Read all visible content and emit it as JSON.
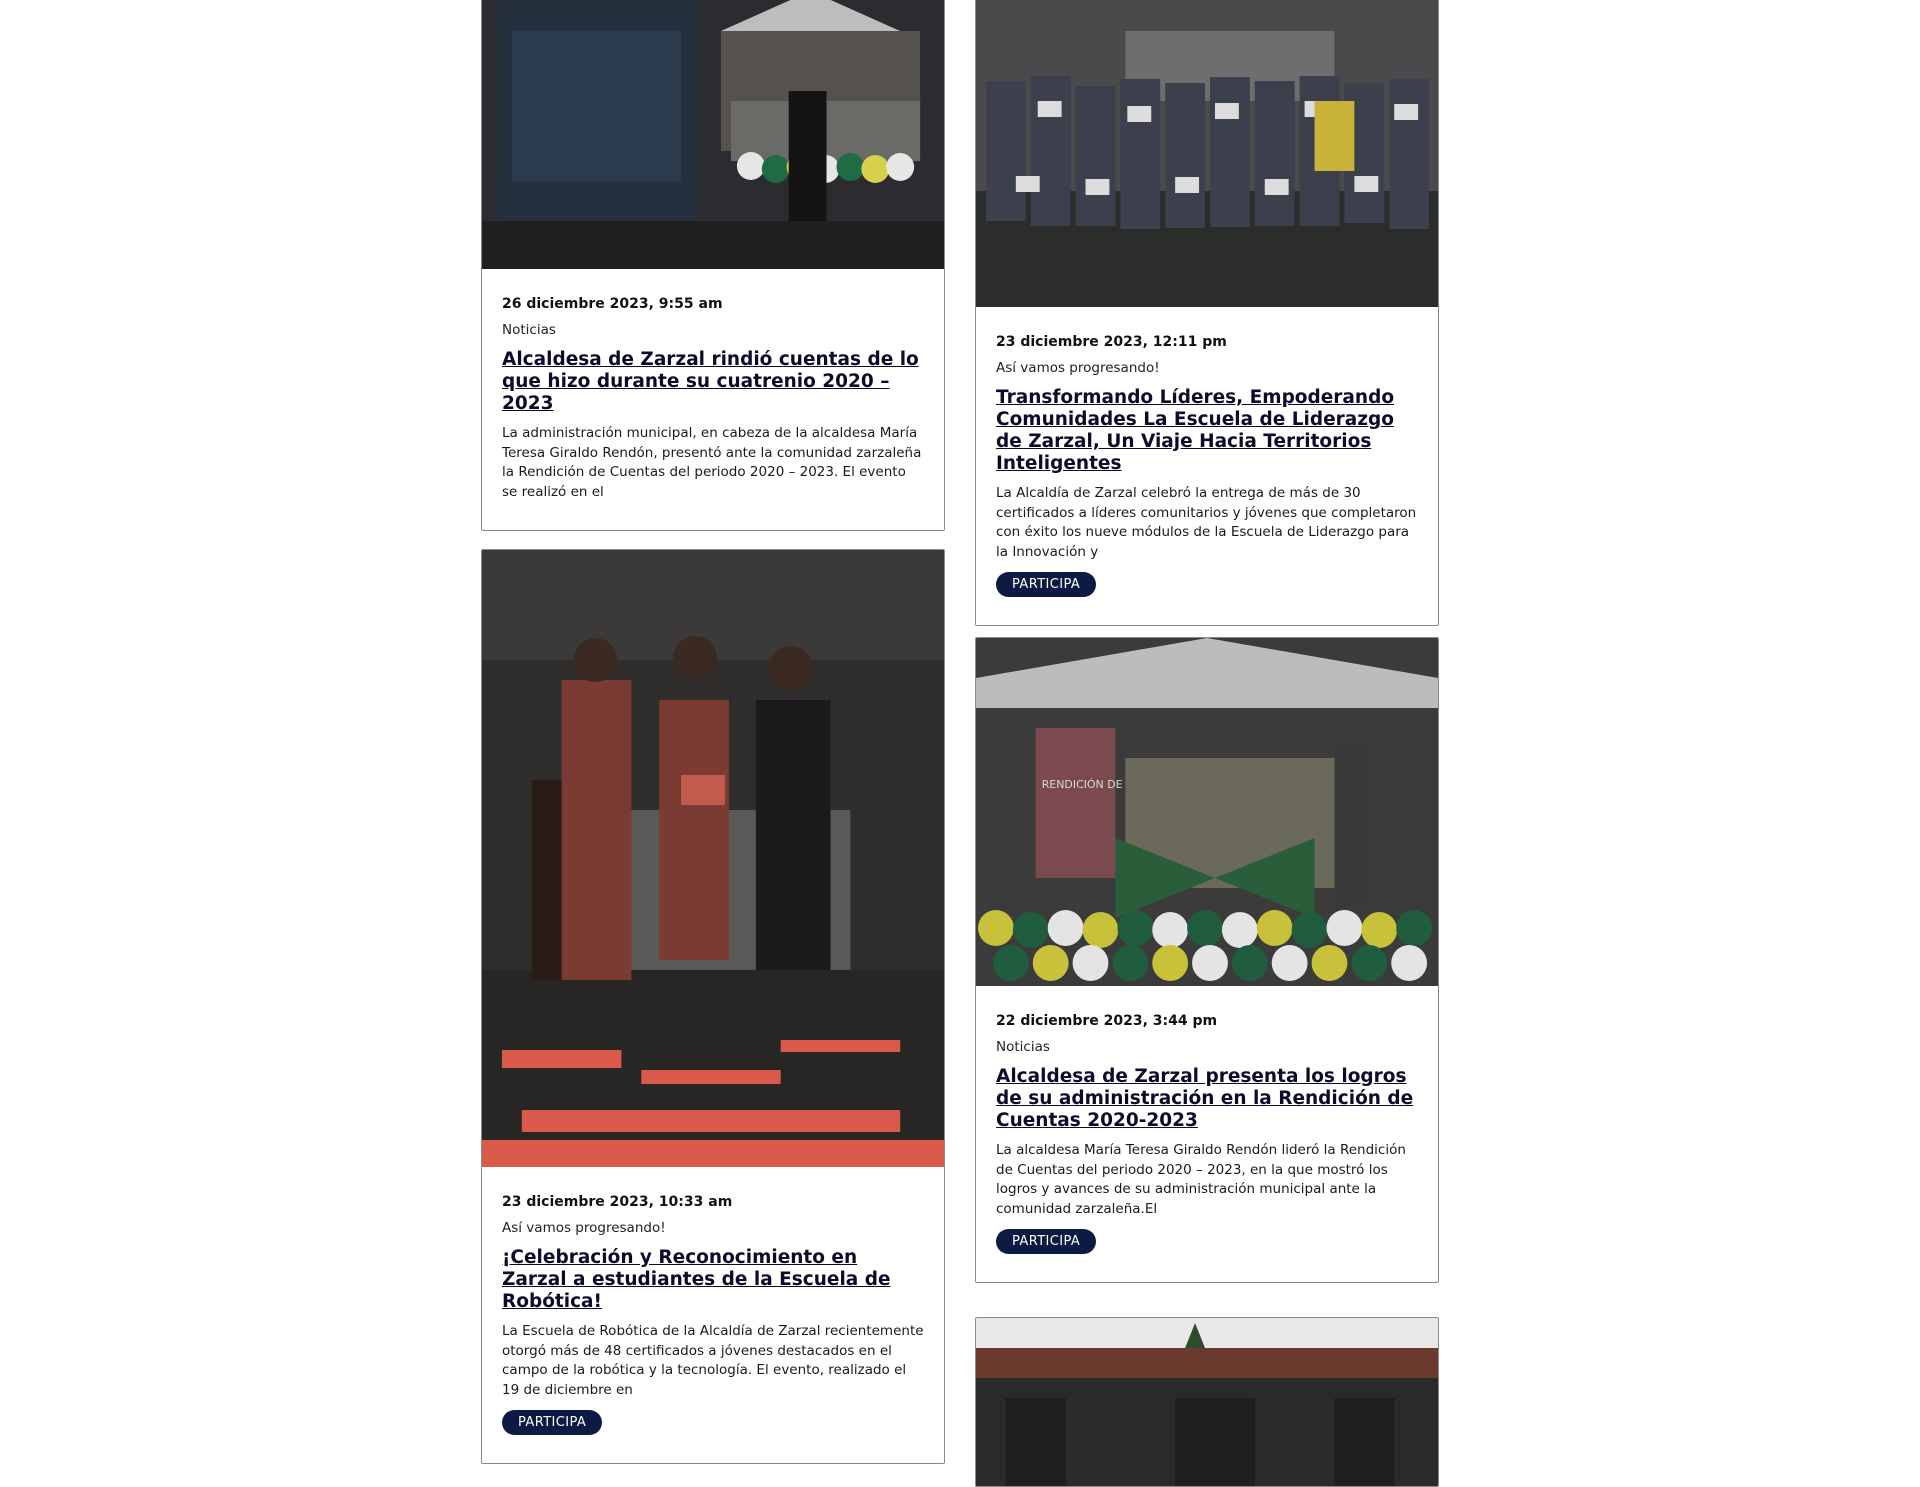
{
  "cards": [
    {
      "date": "26 diciembre 2023, 9:55 am",
      "category": "Noticias",
      "title": "Alcaldesa de Zarzal rindió cuentas de lo que hizo durante su cuatrenio 2020 – 2023",
      "excerpt": " La administración municipal, en cabeza de la alcaldesa María Teresa Giraldo Rendón, presentó ante la comunidad zarzaleña la Rendición de Cuentas del periodo 2020 – 2023. El evento se realizó en el"
    },
    {
      "date": "23 diciembre 2023, 12:11 pm",
      "category": "Así vamos progresando!",
      "title": "Transformando Líderes, Empoderando Comunidades La Escuela de Liderazgo de Zarzal, Un Viaje Hacia Territorios Inteligentes",
      "excerpt": "La Alcaldía de Zarzal celebró la entrega de más de 30 certificados a líderes comunitarios y jóvenes que completaron con éxito los nueve módulos de la Escuela de Liderazgo para la Innovación y",
      "button": "PARTICIPA"
    },
    {
      "date": "23 diciembre 2023, 10:33 am",
      "category": "Así vamos progresando!",
      "title": "¡Celebración y Reconocimiento en Zarzal a estudiantes de la Escuela de Robótica!",
      "excerpt": "La Escuela de Robótica de la Alcaldía de Zarzal recientemente otorgó más de 48 certificados a jóvenes destacados en el campo de la robótica y la tecnología. El evento, realizado el 19 de diciembre en",
      "button": "PARTICIPA"
    },
    {
      "date": "22 diciembre 2023, 3:44 pm",
      "category": "Noticias",
      "title": "Alcaldesa de Zarzal presenta los logros de su administración en la Rendición de Cuentas 2020-2023",
      "excerpt": "La alcaldesa María Teresa Giraldo Rendón lideró la Rendición de Cuentas del periodo 2020 – 2023, en la que mostró los logros y avances de su administración municipal ante la comunidad zarzaleña.El",
      "button": "PARTICIPA"
    }
  ],
  "photo_sign_text": "RENDICIÓN DE CUENTAS"
}
